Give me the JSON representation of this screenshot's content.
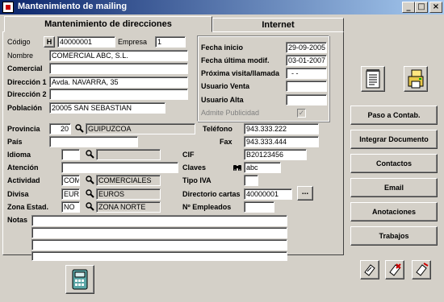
{
  "window": {
    "title": "Mantenimiento de mailing",
    "buttons": {
      "minimize": "_",
      "maximize": "□",
      "close": "×"
    }
  },
  "tabs": [
    {
      "label": "Mantenimiento de direcciones"
    },
    {
      "label": "Internet"
    }
  ],
  "form": {
    "codigo": {
      "label": "Código",
      "h_button": "H",
      "value": "40000001"
    },
    "empresa": {
      "label": "Empresa",
      "value": "1"
    },
    "nombre": {
      "label": "Nombre",
      "value": "COMERCIAL ABC, S.L."
    },
    "comercial": {
      "label": "Comercial",
      "value": ""
    },
    "direccion1": {
      "label": "Dirección 1",
      "value": "Avda. NAVARRA, 35"
    },
    "direccion2": {
      "label": "Dirección 2",
      "value": ""
    },
    "poblacion": {
      "label": "Población",
      "value": "20005 SAN SEBASTIAN"
    },
    "provincia": {
      "label": "Provincia",
      "code": "20",
      "value": "GUIPUZCOA"
    },
    "pais": {
      "label": "País",
      "value": ""
    },
    "idioma": {
      "label": "Idioma",
      "code": "",
      "value": ""
    },
    "atencion": {
      "label": "Atención",
      "value": ""
    },
    "actividad": {
      "label": "Actividad",
      "code": "COM",
      "value": "COMERCIALES"
    },
    "divisa": {
      "label": "Divisa",
      "code": "EUR",
      "value": "EUROS"
    },
    "zona": {
      "label": "Zona Estad.",
      "code": "NO",
      "value": "ZONA NORTE"
    },
    "notas": {
      "label": "Notas",
      "lines": [
        "",
        "",
        "",
        ""
      ]
    },
    "telefono": {
      "label": "Teléfono",
      "value": "943.333.222"
    },
    "fax": {
      "label": "Fax",
      "value": "943.333.444"
    },
    "cif": {
      "label": "CIF",
      "value": "B20123456"
    },
    "claves": {
      "label": "Claves",
      "value": "abc"
    },
    "tipo_iva": {
      "label": "Tipo IVA",
      "value": ""
    },
    "directorio_cartas": {
      "label": "Directorio cartas",
      "value": "40000001",
      "browse": "..."
    },
    "num_empleados": {
      "label": "Nº Empleados",
      "value": ""
    }
  },
  "dates": {
    "fecha_inicio": {
      "label": "Fecha inicio",
      "value": "29-09-2005"
    },
    "fecha_ultima": {
      "label": "Fecha última modif.",
      "value": "03-01-2007"
    },
    "proxima_visita": {
      "label": "Próxima visita/llamada",
      "value": "- -"
    },
    "usuario_venta": {
      "label": "Usuario Venta",
      "value": ""
    },
    "usuario_alta": {
      "label": "Usuario Alta",
      "value": ""
    },
    "admite_publicidad": {
      "label": "Admite Publicidad",
      "checked": true
    }
  },
  "actions": [
    {
      "label": "Paso a Contab."
    },
    {
      "label": "Integrar Documento"
    },
    {
      "label": "Contactos"
    },
    {
      "label": "Email"
    },
    {
      "label": "Anotaciones"
    },
    {
      "label": "Trabajos"
    }
  ],
  "icons": {
    "notepad": "notepad-icon",
    "print": "printer-icon",
    "phone": "phone-icon"
  }
}
